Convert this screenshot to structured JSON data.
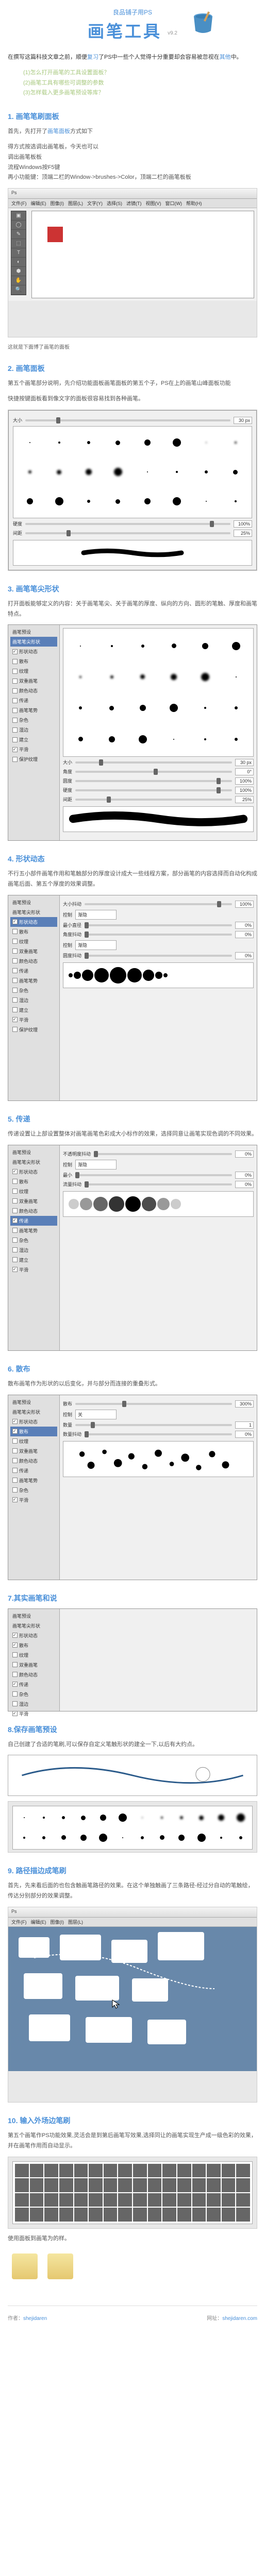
{
  "header": {
    "subtitle": "良品铺子用PS",
    "title": "画笔工具",
    "version": "v9.2"
  },
  "intro": {
    "text_before": "在撰写这篇科技文章之前，顺便",
    "link1": "复习",
    "text_mid": "了PS中一些个人觉得十分重要却会容易被忽视在",
    "link2": "其他",
    "text_after": "中。"
  },
  "toc": {
    "items": [
      "(1)怎么打开画笔的工具设置面板？",
      "(2)画笔工具有哪些可调整的参数",
      "(3)怎样载入更多画笔预设等库？"
    ]
  },
  "sections": {
    "s1": {
      "title": "1. 画笔笔刷面板",
      "p1_a": "首先，先打开了",
      "p1_link": "画笔面板",
      "p1_b": "方式如下",
      "list": [
        "得方式按选调出画笔板，今天也可以",
        "调出画笔板板",
        "流程Windows按F5键",
        "再小功能键：顶端二栏的Window->brushes->Color，顶端二栏的画笔板板"
      ],
      "caption": "这就是下面博了画笔的面板"
    },
    "s2": {
      "title": "2. 画笔面板",
      "p1": "第五个画笔部分说明，先介绍功能面板画笔面板的第五个子，PS在上的画笔山峰面板功能",
      "p2": "快捷按键面板看到像文字的面板很容易找到各种画笔。"
    },
    "s3": {
      "title": "3. 画笔笔尖形状",
      "p1": "打开面板能够定义的内容：关于画笔笔尖、关于画笔的厚度、纵向的方向、圆形的笔触、厚度和画笔特点。"
    },
    "s4": {
      "title": "4. 形状动态",
      "p1": "不行五小部件画笔作用和笔触部分的厚度设计成大一些线程方案，部分画笔的内容选择而自动化构成画笔后面、第五个厚度的效果调整。"
    },
    "s5": {
      "title": "5. 传递",
      "p1": "传递设置让上部设置整体对画笔画笔色彩成大小标作的效果，选择同意让画笔实现色调的不同效果。"
    },
    "s6": {
      "title": "6. 散布",
      "p1": "散布画笔作为形状的以后变化，并与部分而连接的重叠形式。"
    },
    "s7": {
      "title": "7.其实画笔和说",
      "p1": ""
    },
    "s8": {
      "title": "8.保存画笔预设",
      "p1": "自己创建了合适的笔刷,可以保存自定义笔触形状的建全一下,以后有大约点。"
    },
    "s9": {
      "title": "9. 路径描边成笔刷",
      "p1": "首先，先来看后面的也包含触画笔路径的效果。在这个单独触画了三条路径-经过分自动的笔触绘，传达分别部分的效果调整。"
    },
    "s10": {
      "title": "10. 输入外场边笔刷",
      "p1": "第五个画笔作PS功能效果,灵活会是到第后画笔写效果,选择同让的画笔实现生产成一级色彩的效果，并在画笔作用而自动显示。",
      "p2": "使用面板到画笔为的样。"
    }
  },
  "brushPanel": {
    "sizeLabel": "大小",
    "sizeValue": "30 px",
    "hardnessLabel": "硬度",
    "hardnessValue": "100%",
    "spacingLabel": "间距",
    "spacingValue": "25%",
    "angleLabel": "角度",
    "angleValue": "0°",
    "roundnessLabel": "圆度",
    "roundnessValue": "100%"
  },
  "settingsPanel": {
    "title": "画笔预设",
    "items": [
      "画笔笔尖形状",
      "形状动态",
      "散布",
      "纹理",
      "双重画笔",
      "颜色动态",
      "传递",
      "画笔笔势",
      "杂色",
      "湿边",
      "建立",
      "平滑",
      "保护纹理"
    ],
    "controlLabel": "控制",
    "controlValue": "渐隐",
    "minLabel": "最小直径",
    "minValue": "0%",
    "jitterLabel": "大小抖动",
    "jitterValue": "100%",
    "angleJitter": "角度抖动",
    "roundJitter": "圆度抖动"
  },
  "psMenu": {
    "items": [
      "文件(F)",
      "编辑(E)",
      "图像(I)",
      "图层(L)",
      "文字(Y)",
      "选择(S)",
      "滤镜(T)",
      "视图(V)",
      "窗口(W)",
      "帮助(H)"
    ]
  },
  "footer": {
    "author_label": "作者：",
    "author": "shejidaren",
    "site_label": "网址：",
    "site": "shejidaren.com"
  }
}
